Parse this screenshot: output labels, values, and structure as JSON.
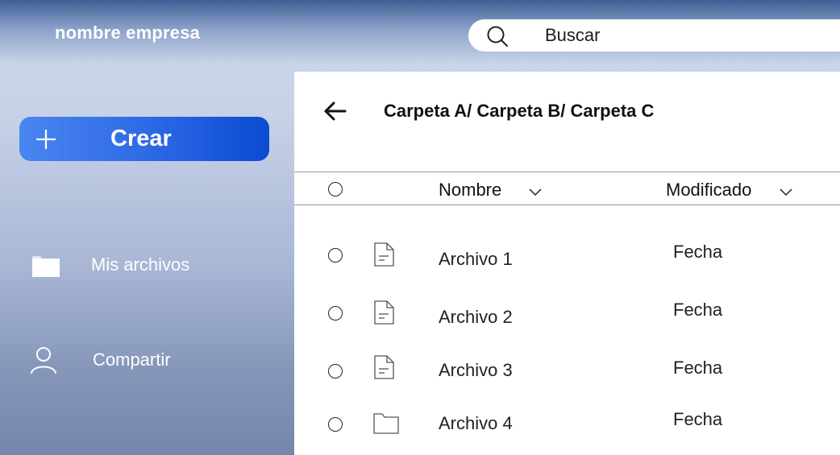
{
  "header": {
    "brand": "nombre empresa",
    "search_placeholder": "Buscar",
    "search_icon": "search-icon"
  },
  "sidebar": {
    "create_label": "Crear",
    "create_icon": "plus-icon",
    "items": [
      {
        "label": "Mis archivos",
        "icon": "folder-icon"
      },
      {
        "label": "Compartir",
        "icon": "user-icon"
      }
    ]
  },
  "main": {
    "back_icon": "arrow-left-icon",
    "breadcrumb": "Carpeta A/ Carpeta B/ Carpeta C",
    "columns": {
      "name": "Nombre",
      "modified": "Modificado"
    },
    "files": [
      {
        "name": "Archivo 1",
        "date": "Fecha",
        "type": "file"
      },
      {
        "name": "Archivo 2",
        "date": "Fecha",
        "type": "file"
      },
      {
        "name": "Archivo 3",
        "date": "Fecha",
        "type": "file"
      },
      {
        "name": "Archivo 4",
        "date": "Fecha",
        "type": "folder"
      }
    ]
  },
  "colors": {
    "accent_start": "#4a86f0",
    "accent_end": "#0a4bd2",
    "sidebar_top": "#c9d5ea",
    "sidebar_bottom": "#7586ab"
  }
}
